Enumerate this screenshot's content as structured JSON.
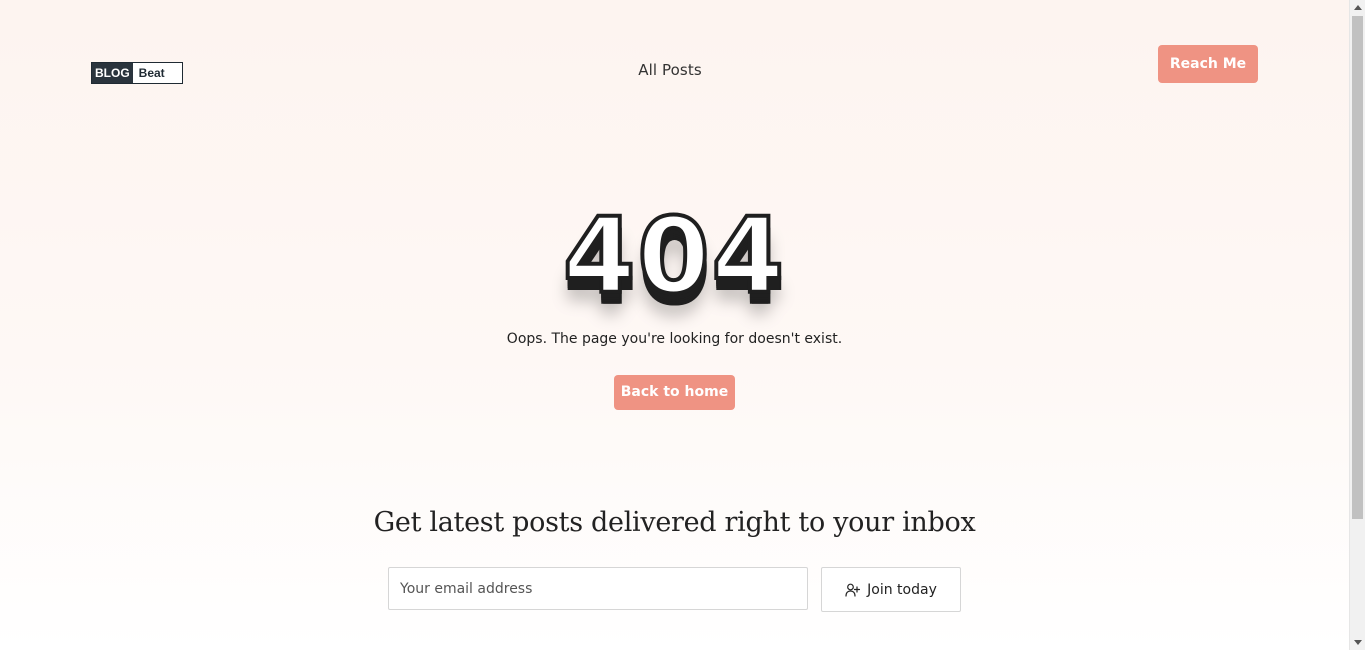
{
  "header": {
    "logo": {
      "part1": "BLOG",
      "part2": "Beat"
    },
    "nav": {
      "all_posts": "All Posts"
    },
    "cta_label": "Reach Me"
  },
  "error": {
    "code": "404",
    "message": "Oops. The page you're looking for doesn't exist.",
    "back_label": "Back to home"
  },
  "newsletter": {
    "title": "Get latest posts delivered right to your inbox",
    "email_placeholder": "Your email address",
    "join_label": "Join today",
    "join_icon": "user-plus-icon"
  },
  "colors": {
    "accent": "#ef9383",
    "dark": "#1f1f1f",
    "background": "#fdf4f0"
  }
}
